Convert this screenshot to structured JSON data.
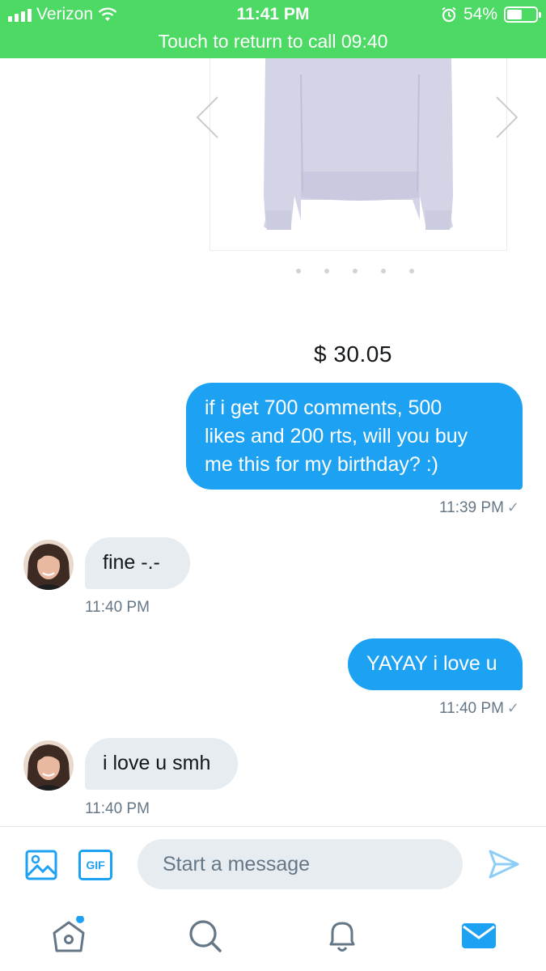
{
  "status_bar": {
    "carrier": "Verizon",
    "time": "11:41 PM",
    "battery": "54%",
    "battery_level": 0.54,
    "call_banner": "Touch to return to call 09:40"
  },
  "product": {
    "price": "$ 30.05",
    "carousel_pages": 5
  },
  "messages": [
    {
      "direction": "sent",
      "lines": [
        "if i get 700 comments, 500",
        "likes and 200 rts, will you buy",
        "me this for my birthday? :)"
      ],
      "time": "11:39 PM",
      "read_mark": "✓"
    },
    {
      "direction": "received",
      "lines": [
        "fine -.-"
      ],
      "time": "11:40 PM"
    },
    {
      "direction": "sent",
      "lines": [
        "YAYAY i love u"
      ],
      "time": "11:40 PM",
      "read_mark": "✓"
    },
    {
      "direction": "received",
      "lines": [
        "i love u smh"
      ],
      "time": "11:40 PM"
    }
  ],
  "compose": {
    "placeholder": "Start a message",
    "gif_label": "GIF"
  },
  "tabs": [
    {
      "name": "home-icon"
    },
    {
      "name": "search-icon"
    },
    {
      "name": "notifications-icon"
    },
    {
      "name": "messages-icon"
    }
  ],
  "colors": {
    "call_green": "#4cd964",
    "accent_blue": "#1da1f2",
    "bubble_gray": "#e6ecf0",
    "muted_text": "#657786"
  }
}
